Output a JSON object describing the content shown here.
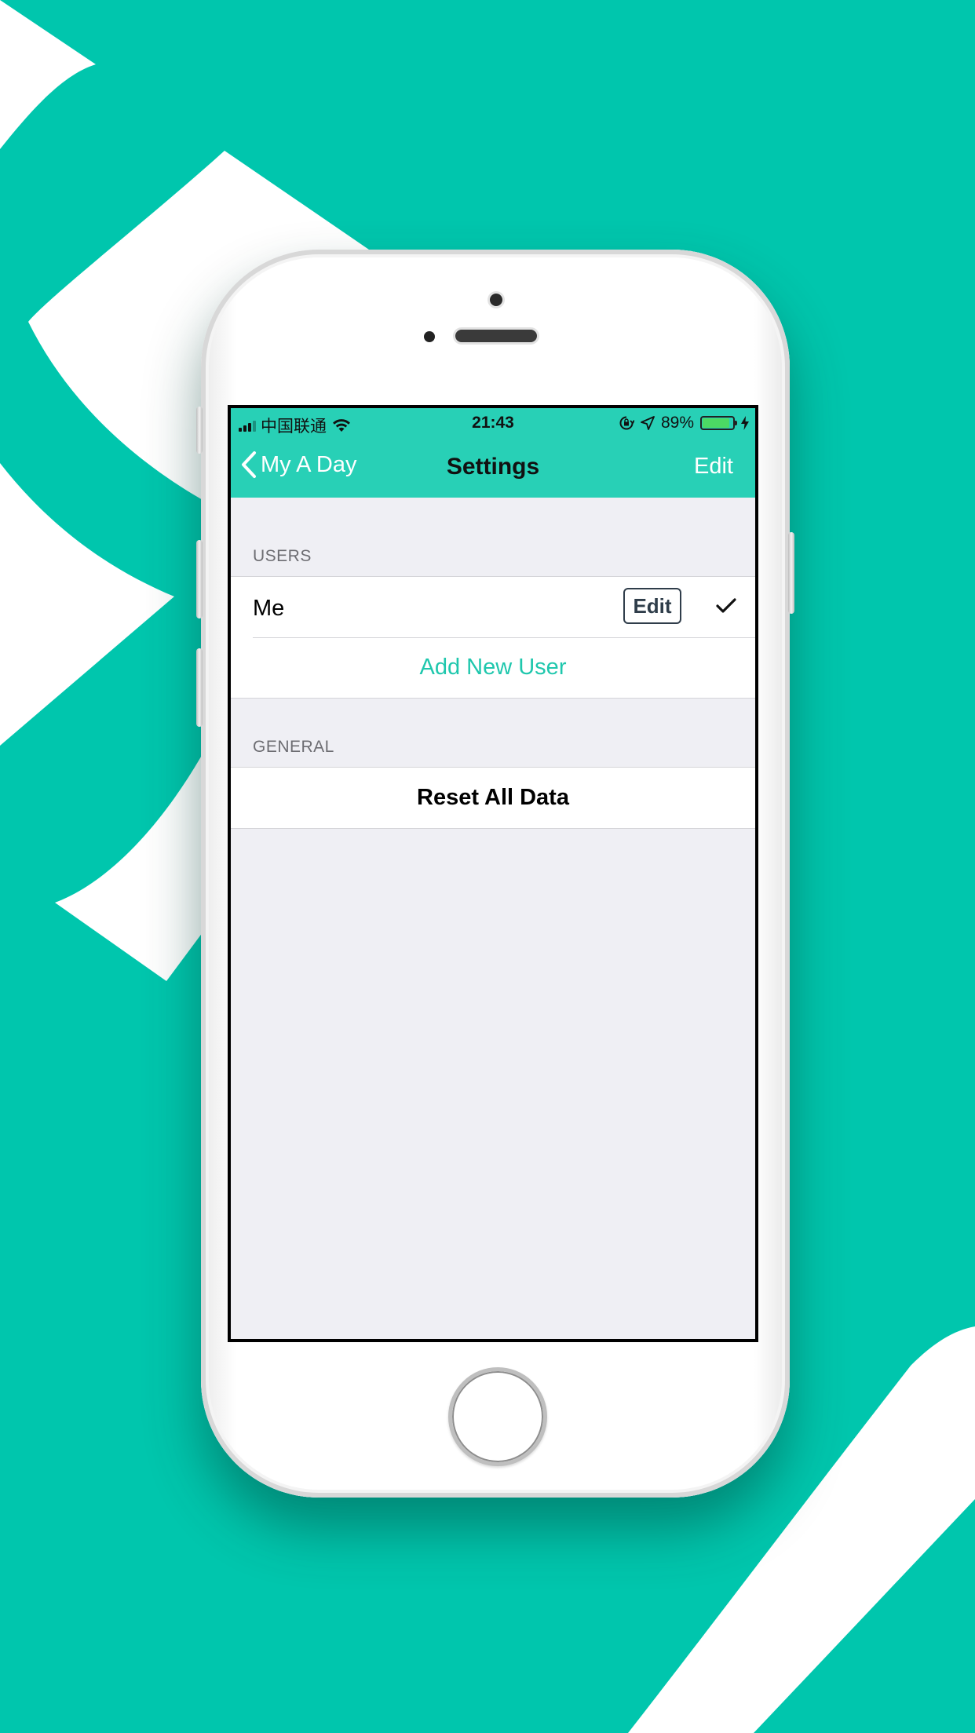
{
  "colors": {
    "background": "#00c6ad",
    "accent": "#28d0b6",
    "link": "#1fc7ad",
    "button_border": "#2f3d4a",
    "battery_fill": "#4cd964"
  },
  "status_bar": {
    "carrier": "中国联通",
    "time": "21:43",
    "battery_percent": "89%",
    "battery_level": 0.89,
    "icons": [
      "signal-icon",
      "wifi-icon",
      "orientation-lock-icon",
      "location-icon",
      "battery-icon",
      "charging-icon"
    ]
  },
  "nav": {
    "back_label": "My A Day",
    "title": "Settings",
    "edit_label": "Edit"
  },
  "sections": {
    "users": {
      "header": "USERS",
      "user_name": "Me",
      "user_edit_label": "Edit",
      "add_user_label": "Add New User"
    },
    "general": {
      "header": "GENERAL",
      "reset_label": "Reset All Data"
    }
  }
}
